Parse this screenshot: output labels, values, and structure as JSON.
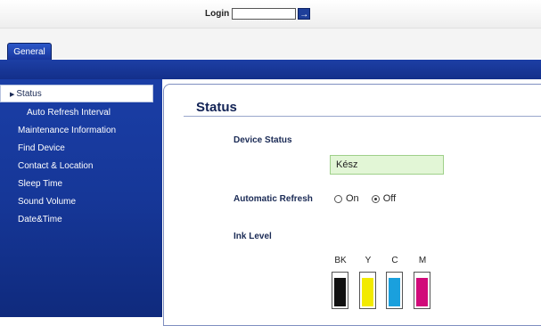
{
  "login": {
    "label": "Login",
    "value": "",
    "button_glyph": "→"
  },
  "tabs": [
    {
      "label": "General"
    }
  ],
  "sidebar": {
    "items": [
      {
        "label": "Status",
        "active": true
      },
      {
        "label": "Auto Refresh Interval",
        "indent": true
      },
      {
        "label": "Maintenance Information"
      },
      {
        "label": "Find Device"
      },
      {
        "label": "Contact & Location"
      },
      {
        "label": "Sleep Time"
      },
      {
        "label": "Sound Volume"
      },
      {
        "label": "Date&Time"
      }
    ]
  },
  "main": {
    "title": "Status",
    "device_status_label": "Device Status",
    "device_status_value": "Kész",
    "auto_refresh_label": "Automatic Refresh",
    "refresh_options": [
      {
        "label": "On",
        "checked": false
      },
      {
        "label": "Off",
        "checked": true
      }
    ],
    "ink_level_label": "Ink Level",
    "inks": [
      {
        "label": "BK",
        "color": "#111111",
        "level": 0.85
      },
      {
        "label": "Y",
        "color": "#f2ea00",
        "level": 0.85
      },
      {
        "label": "C",
        "color": "#1aa0dd",
        "level": 0.85
      },
      {
        "label": "M",
        "color": "#d10a7a",
        "level": 0.85
      }
    ]
  },
  "colors": {
    "sidebar": "#163798",
    "status_bg": "#e2f6d6"
  }
}
